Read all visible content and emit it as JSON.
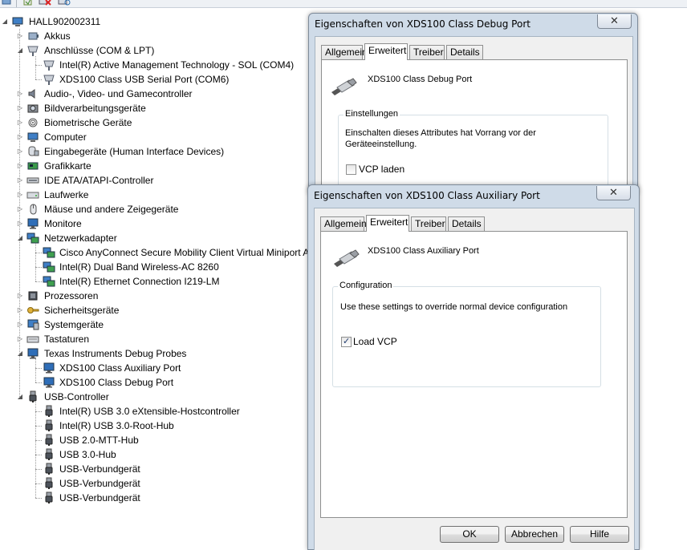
{
  "tree": {
    "root": "HALL902002311",
    "nodes": [
      {
        "label": "Akkus",
        "icon": "battery-icon"
      },
      {
        "label": "Anschlüsse (COM & LPT)",
        "icon": "port-icon"
      },
      {
        "label": "Intel(R) Active Management Technology - SOL (COM4)",
        "icon": "port-icon"
      },
      {
        "label": "XDS100 Class USB Serial Port (COM6)",
        "icon": "port-icon"
      },
      {
        "label": "Audio-, Video- und Gamecontroller",
        "icon": "speaker-icon"
      },
      {
        "label": "Bildverarbeitungsgeräte",
        "icon": "camera-icon"
      },
      {
        "label": "Biometrische Geräte",
        "icon": "fingerprint-icon"
      },
      {
        "label": "Computer",
        "icon": "computer-icon"
      },
      {
        "label": "Eingabegeräte (Human Interface Devices)",
        "icon": "hid-icon"
      },
      {
        "label": "Grafikkarte",
        "icon": "display-adapter-icon"
      },
      {
        "label": "IDE ATA/ATAPI-Controller",
        "icon": "ide-icon"
      },
      {
        "label": "Laufwerke",
        "icon": "drive-icon"
      },
      {
        "label": "Mäuse und andere Zeigegeräte",
        "icon": "mouse-icon"
      },
      {
        "label": "Monitore",
        "icon": "monitor-icon"
      },
      {
        "label": "Netzwerkadapter",
        "icon": "network-icon"
      },
      {
        "label": "Cisco AnyConnect Secure Mobility Client Virtual Miniport Adapter",
        "icon": "network-icon"
      },
      {
        "label": "Intel(R) Dual Band Wireless-AC 8260",
        "icon": "network-icon"
      },
      {
        "label": "Intel(R) Ethernet Connection I219-LM",
        "icon": "network-icon"
      },
      {
        "label": "Prozessoren",
        "icon": "cpu-icon"
      },
      {
        "label": "Sicherheitsgeräte",
        "icon": "key-icon"
      },
      {
        "label": "Systemgeräte",
        "icon": "system-icon"
      },
      {
        "label": "Tastaturen",
        "icon": "keyboard-icon"
      },
      {
        "label": "Texas Instruments Debug Probes",
        "icon": "monitor-icon"
      },
      {
        "label": "XDS100 Class Auxiliary Port",
        "icon": "monitor-icon"
      },
      {
        "label": "XDS100 Class Debug Port",
        "icon": "monitor-icon"
      },
      {
        "label": "USB-Controller",
        "icon": "usb-icon"
      },
      {
        "label": "Intel(R) USB 3.0 eXtensible-Hostcontroller",
        "icon": "usb-icon"
      },
      {
        "label": "Intel(R) USB 3.0-Root-Hub",
        "icon": "usb-icon"
      },
      {
        "label": "USB 2.0-MTT-Hub",
        "icon": "usb-icon"
      },
      {
        "label": "USB 3.0-Hub",
        "icon": "usb-icon"
      },
      {
        "label": "USB-Verbundgerät",
        "icon": "usb-icon"
      },
      {
        "label": "USB-Verbundgerät",
        "icon": "usb-icon"
      },
      {
        "label": "USB-Verbundgerät",
        "icon": "usb-icon"
      }
    ]
  },
  "dialog_back": {
    "title": "Eigenschaften von XDS100 Class Debug Port",
    "close": "✕",
    "tabs": [
      "Allgemein",
      "Erweitert",
      "Treiber",
      "Details"
    ],
    "device_name": "XDS100 Class Debug Port",
    "group_label": "Einstellungen",
    "description_line1": "Einschalten dieses Attributes hat Vorrang vor der",
    "description_line2": "Geräteeinstellung.",
    "checkbox_label": "VCP laden",
    "checkbox_checked": false
  },
  "dialog_front": {
    "title": "Eigenschaften von XDS100 Class Auxiliary Port",
    "close": "✕",
    "tabs": [
      "Allgemein",
      "Erweitert",
      "Treiber",
      "Details"
    ],
    "device_name": "XDS100 Class Auxiliary Port",
    "group_label": "Configuration",
    "description": "Use these settings to override normal device configuration",
    "checkbox_label": "Load VCP",
    "checkbox_checked": true,
    "tick": "✓",
    "buttons": {
      "ok": "OK",
      "cancel": "Abbrechen",
      "help": "Hilfe"
    }
  }
}
